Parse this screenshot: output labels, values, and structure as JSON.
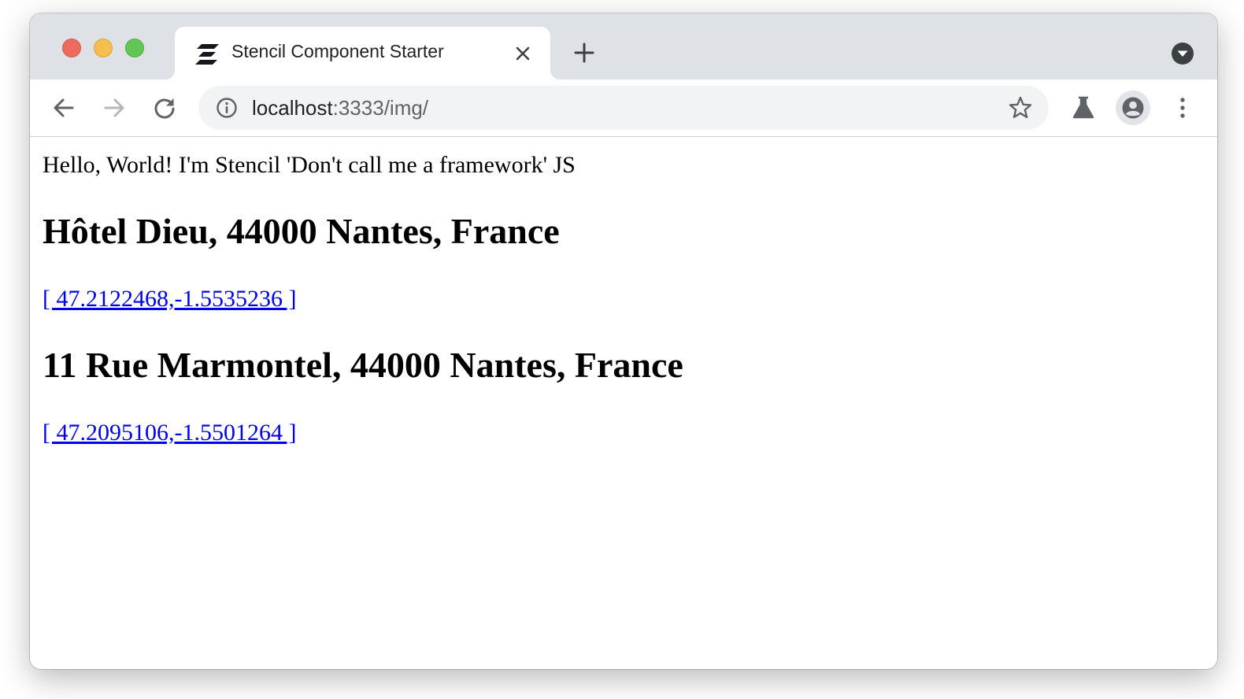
{
  "browser": {
    "tab": {
      "title": "Stencil Component Starter",
      "favicon_icon": "stencil-logo-icon"
    },
    "address_bar": {
      "host": "localhost",
      "path": ":3333/img/"
    }
  },
  "page": {
    "greeting": "Hello, World! I'm Stencil 'Don't call me a framework' JS",
    "places": [
      {
        "address": "Hôtel Dieu, 44000 Nantes, France",
        "coords": "[ 47.2122468,-1.5535236 ]"
      },
      {
        "address": "11 Rue Marmontel, 44000 Nantes, France",
        "coords": "[ 47.2095106,-1.5501264 ]"
      }
    ]
  },
  "colors": {
    "tabstrip": "#dee1e6",
    "link": "#0000ee",
    "close": "#ed6a5e",
    "minimize": "#f5bf4f",
    "zoom": "#62c554"
  }
}
